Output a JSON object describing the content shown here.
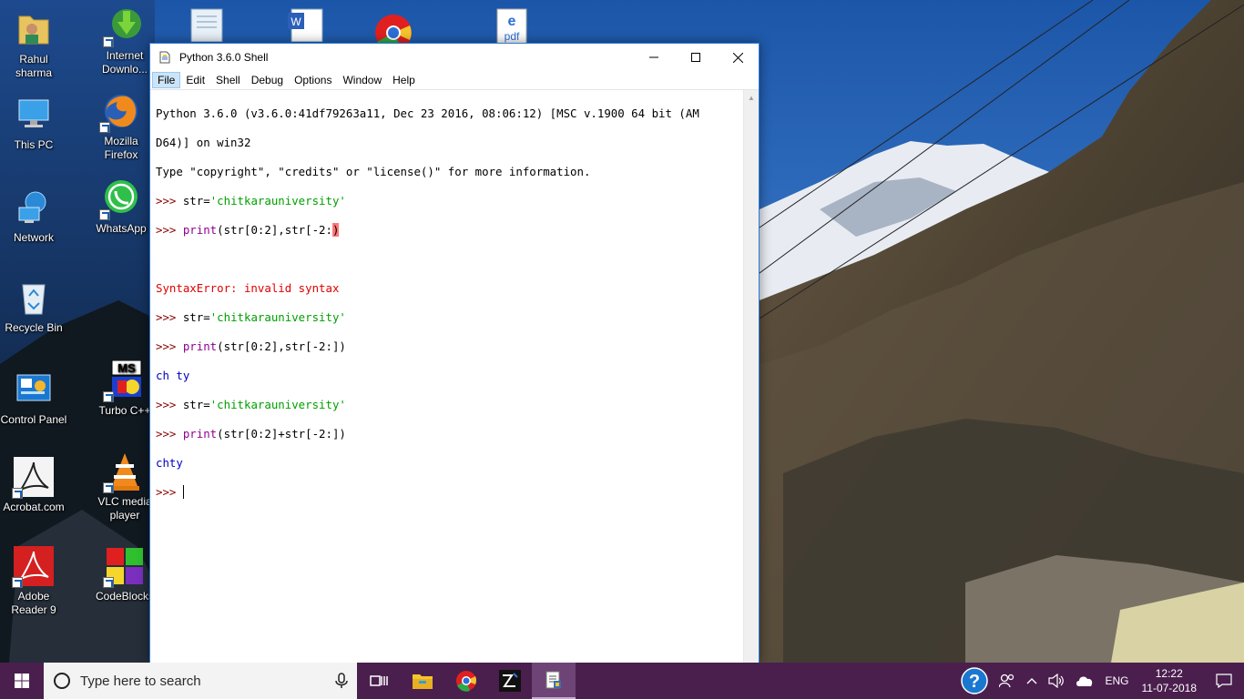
{
  "desktop": {
    "icons": [
      {
        "label": "Rahul sharma",
        "icon": "user-folder-icon"
      },
      {
        "label": "This PC",
        "icon": "computer-icon"
      },
      {
        "label": "Network",
        "icon": "network-icon"
      },
      {
        "label": "Recycle Bin",
        "icon": "recycle-bin-icon"
      },
      {
        "label": "Control Panel",
        "icon": "control-panel-icon"
      },
      {
        "label": "Acrobat.com",
        "icon": "acrobat-icon"
      },
      {
        "label": "Adobe Reader 9",
        "icon": "adobe-reader-icon"
      },
      {
        "label": "Internet Downlo...",
        "icon": "internet-download-manager-icon"
      },
      {
        "label": "Mozilla Firefox",
        "icon": "firefox-icon"
      },
      {
        "label": "WhatsApp",
        "icon": "whatsapp-icon"
      },
      {
        "label": "Turbo C++",
        "icon": "turbo-cpp-icon"
      },
      {
        "label": "VLC media player",
        "icon": "vlc-icon"
      },
      {
        "label": "CodeBlocks",
        "icon": "codeblocks-icon"
      }
    ]
  },
  "window": {
    "title": "Python 3.6.0 Shell",
    "menu": [
      "File",
      "Edit",
      "Shell",
      "Debug",
      "Options",
      "Window",
      "Help"
    ],
    "shell_lines": {
      "l1": "Python 3.6.0 (v3.6.0:41df79263a11, Dec 23 2016, 08:06:12) [MSC v.1900 64 bit (AM",
      "l2": "D64)] on win32",
      "l3": "Type \"copyright\", \"credits\" or \"license()\" for more information.",
      "prompt": ">>> ",
      "str_assign_prefix": "str=",
      "str_literal": "'chitkarauniversity'",
      "print_kw": "print",
      "cmd1_a": "(str[0:2],str[-2:",
      "cmd1_err_char": ")",
      "error": "SyntaxError: invalid syntax",
      "cmd2": "(str[0:2],str[-2:])",
      "out2": "ch ty",
      "cmd3": "(str[0:2]+str[-2:])",
      "out3": "chty"
    }
  },
  "taskbar": {
    "search_placeholder": "Type here to search",
    "pinned": [
      "task-view-icon",
      "file-explorer-icon",
      "chrome-icon",
      "turbo-c-icon",
      "idle-python-icon"
    ],
    "language": "ENG",
    "time": "12:22",
    "date": "11-07-2018"
  },
  "colors": {
    "taskbar": "#4a1f4e",
    "prompt": "#8b0000",
    "keyword": "#900090",
    "string": "#00a000",
    "output": "#0000c0",
    "error": "#e00000"
  }
}
